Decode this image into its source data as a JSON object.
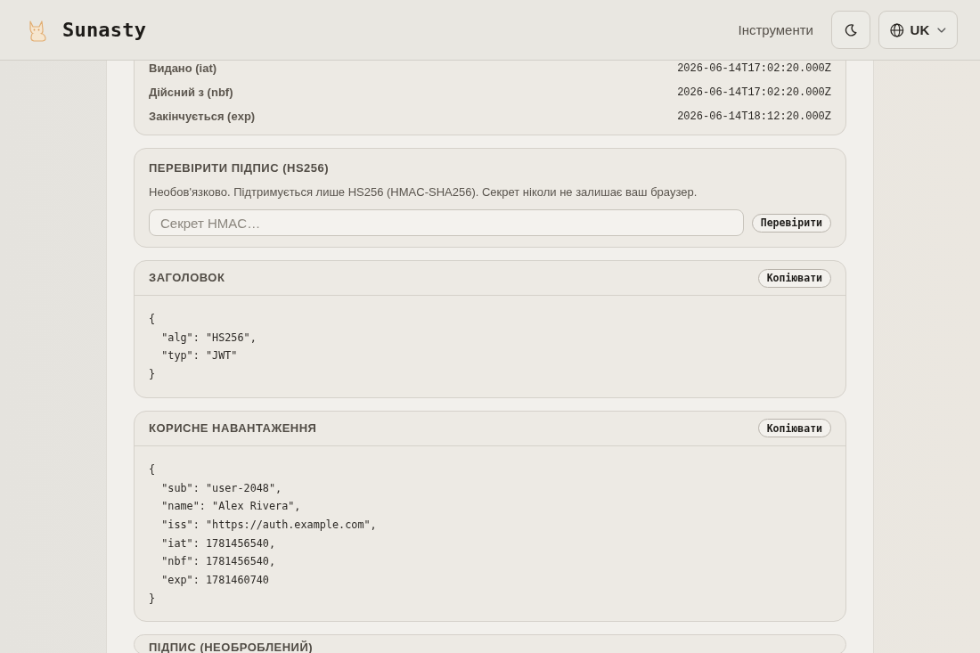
{
  "header": {
    "brand": "Sunasty",
    "nav": [
      {
        "label": "Інструменти"
      }
    ],
    "language": {
      "label": "UK"
    }
  },
  "claims": [
    {
      "label": "Видано (iat)",
      "value": "2026-06-14T17:02:20.000Z"
    },
    {
      "label": "Дійсний з (nbf)",
      "value": "2026-06-14T17:02:20.000Z"
    },
    {
      "label": "Закінчується (exp)",
      "value": "2026-06-14T18:12:20.000Z"
    }
  ],
  "verify": {
    "title": "ПЕРЕВІРИТИ ПІДПИС (HS256)",
    "description": "Необов'язково. Підтримується лише HS256 (HMAC-SHA256). Секрет ніколи не залишає ваш браузер.",
    "secret": {
      "placeholder": "Секрет HMAC…"
    },
    "button": "Перевірити"
  },
  "sections": [
    {
      "title": "ЗАГОЛОВОК",
      "copy_button": "Копіювати",
      "code": "{\n  \"alg\": \"HS256\",\n  \"typ\": \"JWT\"\n}"
    },
    {
      "title": "КОРИСНЕ НАВАНТАЖЕННЯ",
      "copy_button": "Копіювати",
      "code": "{\n  \"sub\": \"user-2048\",\n  \"name\": \"Alex Rivera\",\n  \"iss\": \"https://auth.example.com\",\n  \"iat\": 1781456540,\n  \"nbf\": 1781456540,\n  \"exp\": 1781460740\n}"
    },
    {
      "title": "ПІДПИС (НЕОБРОБЛЕНИЙ)"
    }
  ]
}
